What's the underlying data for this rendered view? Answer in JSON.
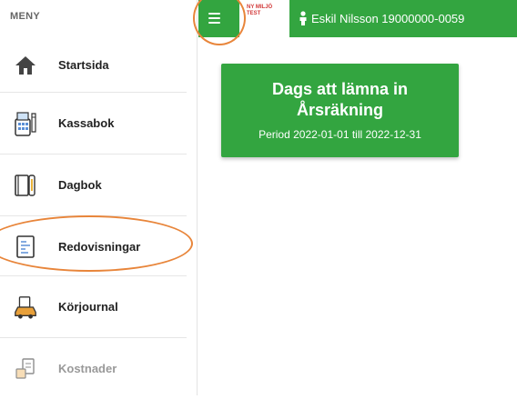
{
  "sidebar": {
    "title": "MENY",
    "items": [
      {
        "label": "Startsida",
        "icon": "home-icon"
      },
      {
        "label": "Kassabok",
        "icon": "cash-register-icon"
      },
      {
        "label": "Dagbok",
        "icon": "journal-icon"
      },
      {
        "label": "Redovisningar",
        "icon": "report-document-icon"
      },
      {
        "label": "Körjournal",
        "icon": "car-icon"
      },
      {
        "label": "Kostnader",
        "icon": "costs-icon",
        "state": "disabled"
      }
    ]
  },
  "topbar": {
    "logo_line1": "NY MILJÖ",
    "logo_line2": "TEST",
    "user": "Eskil Nilsson 19000000-0059"
  },
  "card": {
    "title_line1": "Dags att lämna in",
    "title_line2": "Årsräkning",
    "subtitle": "Period 2022-01-01 till 2022-12-31"
  },
  "colors": {
    "brand_green": "#33a540",
    "annotation_orange": "#e8853a",
    "logo_red": "#d23a3a"
  }
}
